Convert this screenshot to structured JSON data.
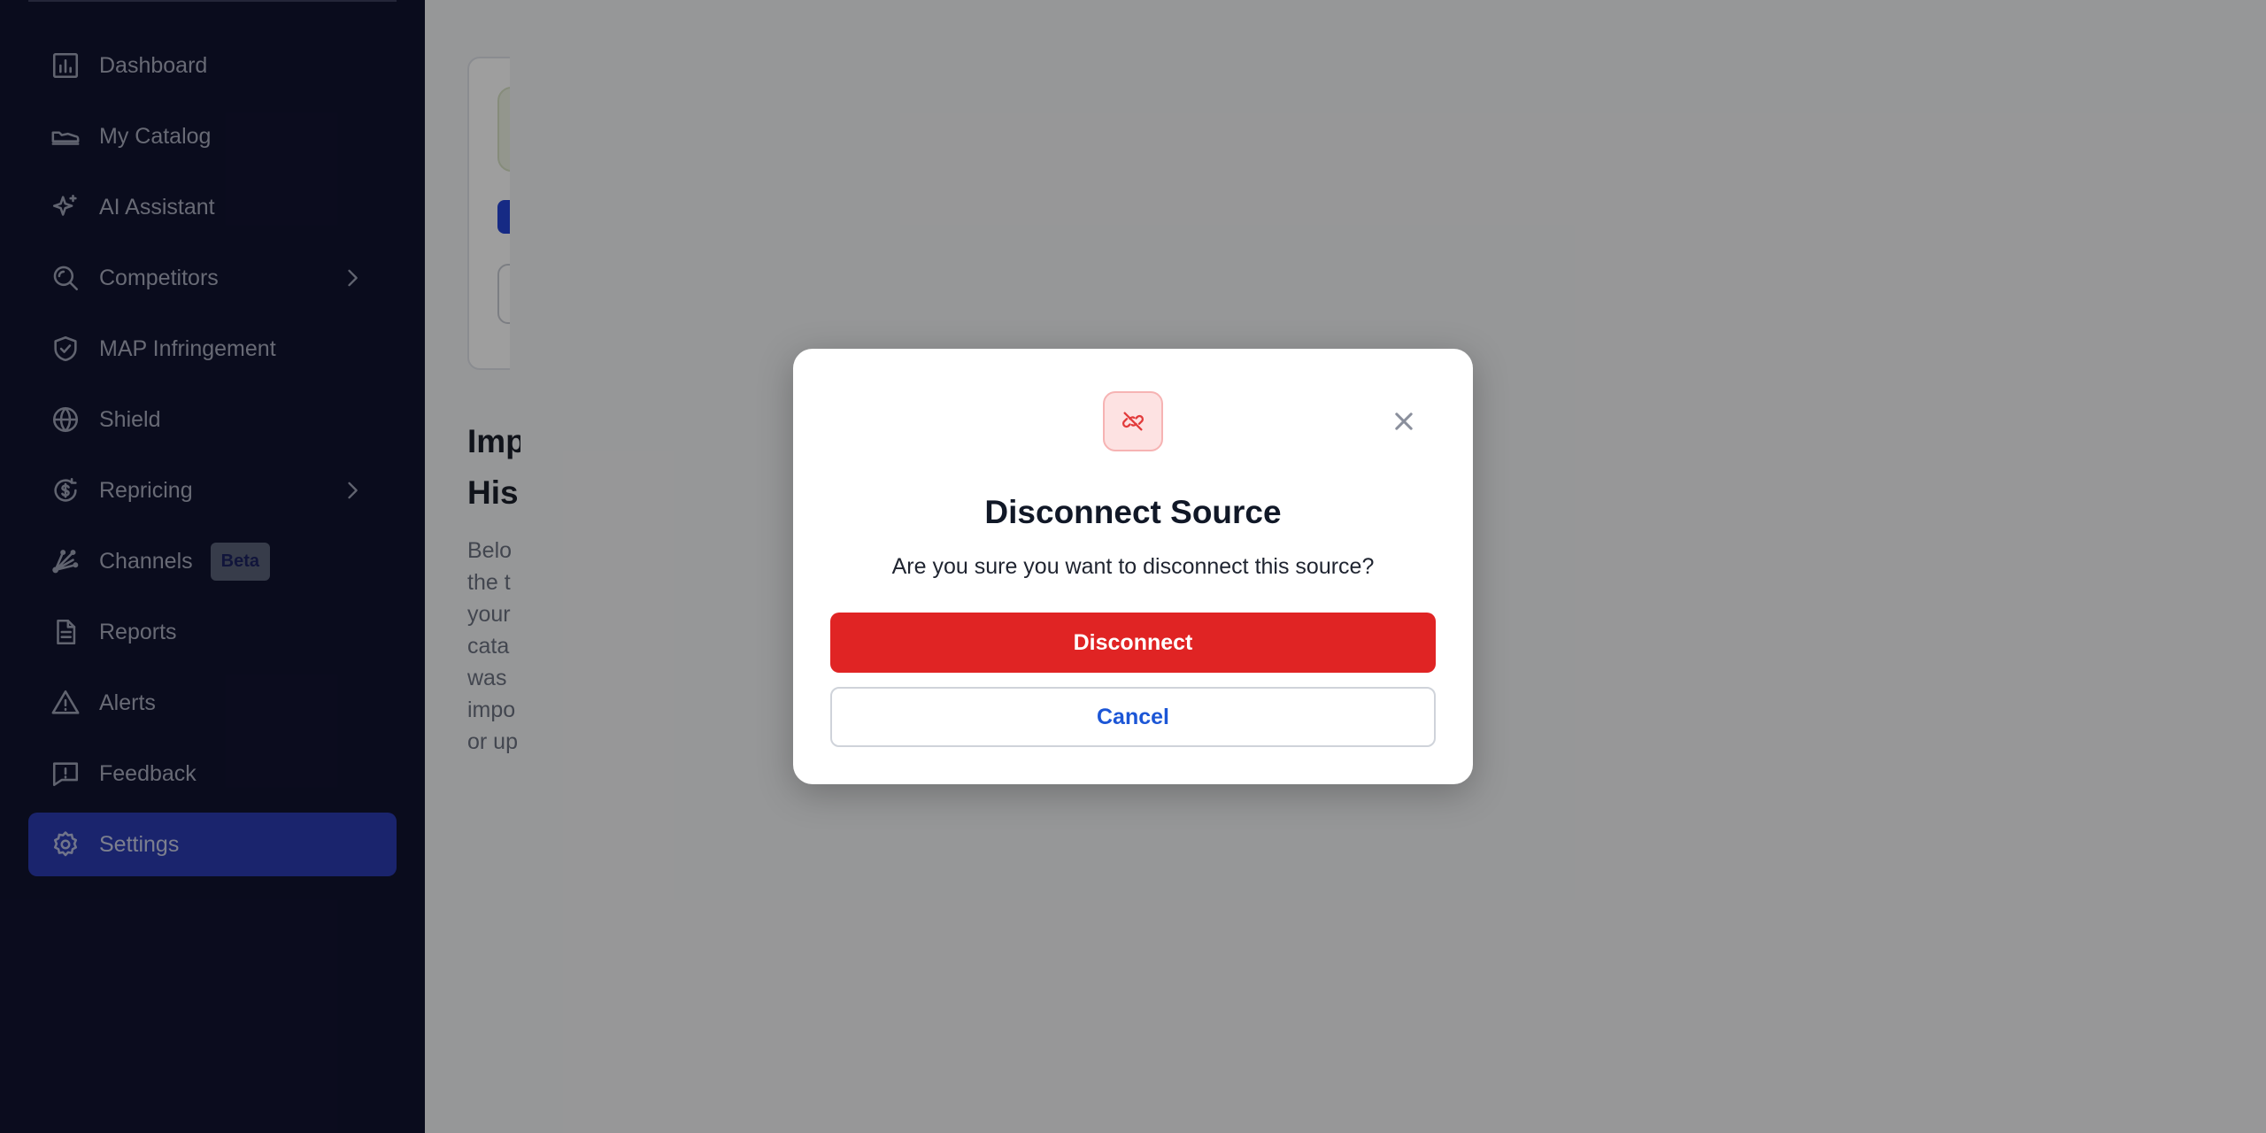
{
  "sidebar": {
    "items": [
      {
        "label": "Dashboard",
        "icon": "bar-chart-icon"
      },
      {
        "label": "My Catalog",
        "icon": "sneaker-icon"
      },
      {
        "label": "AI Assistant",
        "icon": "sparkles-icon"
      },
      {
        "label": "Competitors",
        "icon": "search-eye-icon",
        "has_chevron": true
      },
      {
        "label": "MAP Infringement",
        "icon": "shield-check-icon"
      },
      {
        "label": "Shield",
        "icon": "globe-icon"
      },
      {
        "label": "Repricing",
        "icon": "dollar-cycle-icon",
        "has_chevron": true
      },
      {
        "label": "Channels",
        "icon": "channels-icon",
        "badge": "Beta"
      },
      {
        "label": "Reports",
        "icon": "document-icon"
      },
      {
        "label": "Alerts",
        "icon": "warning-icon"
      },
      {
        "label": "Feedback",
        "icon": "feedback-icon"
      },
      {
        "label": "Settings",
        "icon": "gear-icon",
        "active": true
      }
    ]
  },
  "main": {
    "section_title_lines": [
      "Imp",
      "His"
    ],
    "section_text_lines": [
      "Belo",
      "the t",
      "your",
      "cata",
      "was",
      "impo",
      "or up"
    ]
  },
  "modal": {
    "icon": "unlink-icon",
    "title": "Disconnect Source",
    "message": "Are you sure you want to disconnect this source?",
    "confirm_label": "Disconnect",
    "cancel_label": "Cancel"
  },
  "colors": {
    "sidebar_bg": "#111430",
    "active_bg": "#2a3bb0",
    "danger": "#e02424",
    "link_blue": "#1c56d6"
  }
}
